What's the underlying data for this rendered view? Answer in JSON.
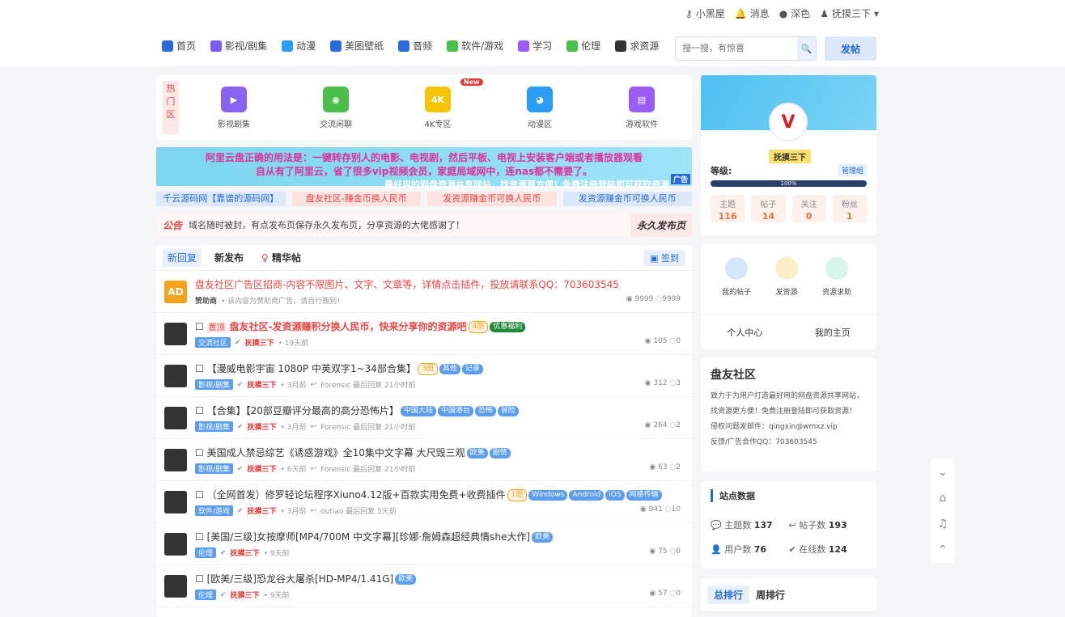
{
  "user": {
    "blackhouse": "小黑屋",
    "messages": "消息",
    "dark": "深色",
    "username": "抚摸三下"
  },
  "nav": {
    "items": [
      {
        "label": "首页",
        "color": "#2a6bd6"
      },
      {
        "label": "影视/剧集",
        "color": "#7b5cf5"
      },
      {
        "label": "动漫",
        "color": "#2a9df4"
      },
      {
        "label": "美图壁纸",
        "color": "#2a6bd6"
      },
      {
        "label": "音频",
        "color": "#2a6bd6"
      },
      {
        "label": "软件/游戏",
        "color": "#4bbf4b"
      },
      {
        "label": "学习",
        "color": "#9b5cf5"
      },
      {
        "label": "伦理",
        "color": "#4bbf4b"
      },
      {
        "label": "求资源",
        "color": "#333333"
      }
    ]
  },
  "search": {
    "placeholder": "搜一搜，有惊喜"
  },
  "post_label": "发帖",
  "hot": {
    "label": "热门区",
    "items": [
      {
        "label": "影视剧集",
        "icon": "video-icon",
        "color": "#8a63f2",
        "glyph": "▶"
      },
      {
        "label": "交流闲聊",
        "icon": "wechat-icon",
        "color": "#4bbf4b",
        "glyph": "◉"
      },
      {
        "label": "4K专区",
        "icon": "4k-icon",
        "color": "#f5c400",
        "glyph": "4K",
        "new": "New"
      },
      {
        "label": "动漫区",
        "icon": "bear-icon",
        "color": "#2a9df4",
        "glyph": "◕"
      },
      {
        "label": "游戏软件",
        "icon": "book-icon",
        "color": "#9b5cf5",
        "glyph": "▤"
      }
    ]
  },
  "banner": {
    "line1": "阿里云盘正确的用法是：一键转存别人的电影、电视剧，然后平板、电视上安装客户端或者播放器观看",
    "line2": "自从有了阿里云，省了很多vip视频会员，家庭局域网中，连nas都不需要了。",
    "line3": "最好用的网盘资源共享网站，找资源更方便！免费注册登陆即可获取资源",
    "tag": "广告"
  },
  "links": [
    {
      "label": "千云源码网【靠谱的源码网】",
      "bg": "#dce8f8",
      "color": "#2a6bd6"
    },
    {
      "label": "盘友社区-赚金币换人民币",
      "bg": "#fde2e2",
      "color": "#e44"
    },
    {
      "label": "发资源赚金币可换人民币",
      "bg": "#fde2e2",
      "color": "#e44"
    },
    {
      "label": "发资源赚金币可换人民币",
      "bg": "#dce8f8",
      "color": "#2a6bd6"
    }
  ],
  "notice": {
    "label": "公告",
    "text": "域名随时被封，有点发布页保存永久发布页，分享资源的大佬感谢了！",
    "perm": "永久发布页"
  },
  "feed_tabs": {
    "new_reply": "新回复",
    "new_post": "新发布",
    "essence": "精华帖",
    "signin": "签到"
  },
  "posts": [
    {
      "title": "盘友社区广告区招商-内容不限图片、文字、文章等，详情点击插件，投放请联系QQ：703603545",
      "titleColor": "#e44",
      "meta1": "赞助商",
      "meta2": "• 该内容为赞助商广告，请自行甄别！",
      "views": "9999",
      "replies": "9999",
      "ad": true
    },
    {
      "title": "盘友社区-发资源赚积分换人民币，快来分享你的资源吧",
      "prefix": "置顶",
      "titleColor": "#e44",
      "badge": "4图",
      "badge2": "优惠福利",
      "cat": "交流社区",
      "user": "抚摸三下",
      "time": "• 19天前",
      "views": "105",
      "replies": "0"
    },
    {
      "title": "【漫威电影宇宙 1080P 中英双字1~34部合集】",
      "badge": "3图",
      "tags": [
        "其他",
        "记录"
      ],
      "cat": "影视/剧集",
      "user": "抚摸三下",
      "time": "• 3月前",
      "last": "Forensic 最后回复 21小时前",
      "views": "312",
      "replies": "3"
    },
    {
      "title": "【合集】【20部豆瓣评分最高的高分恐怖片】",
      "tags": [
        "中国大陆",
        "中国港台",
        "恐怖",
        "冒险"
      ],
      "cat": "影视/剧集",
      "user": "抚摸三下",
      "time": "• 3月前",
      "last": "Forensic 最后回复 21小时前",
      "views": "264",
      "replies": "2"
    },
    {
      "title": "美国成人禁忌综艺《诱惑游戏》全10集中文字幕 大尺毁三观",
      "tags": [
        "欧美",
        "剧情"
      ],
      "cat": "影视/剧集",
      "user": "抚摸三下",
      "time": "• 6天前",
      "last": "Forensic 最后回复 21小时前",
      "views": "63",
      "replies": "2"
    },
    {
      "title": "（全网首发）修罗轻论坛程序Xiuno4.12版+百款实用免费+收费插件",
      "badge": "1图",
      "tags": [
        "Windows",
        "Android",
        "iOS",
        "网络传输"
      ],
      "cat": "软件/游戏",
      "user": "抚摸三下",
      "time": "• 3月前",
      "last": "outiao 最后回复 5天前",
      "views": "941",
      "replies": "10"
    },
    {
      "title": "[美国/三级]女按摩师[MP4/700M 中文字幕][珍娜·詹姆森超经典情she大作]",
      "tags": [
        "欧美"
      ],
      "cat": "伦理",
      "user": "抚摸三下",
      "time": "• 9天前",
      "views": "75",
      "replies": "0"
    },
    {
      "title": "[欧美/三级]恐龙谷大屠杀[HD-MP4/1.41G]",
      "tags": [
        "欧美"
      ],
      "cat": "伦理",
      "user": "抚摸三下",
      "time": "• 9天前",
      "views": "57",
      "replies": "0"
    }
  ],
  "profile": {
    "name": "抚摸三下",
    "level": "等级:",
    "group": "管理组",
    "progress": "100%",
    "stats": [
      {
        "k": "主题",
        "v": "116"
      },
      {
        "k": "帖子",
        "v": "14"
      },
      {
        "k": "关注",
        "v": "0"
      },
      {
        "k": "粉丝",
        "v": "1"
      }
    ]
  },
  "actions": {
    "items": [
      {
        "label": "我的帖子",
        "color": "#d6e6fb"
      },
      {
        "label": "发资源",
        "color": "#fbefc6"
      },
      {
        "label": "资源求助",
        "color": "#d6f5ec"
      }
    ],
    "center": "个人中心",
    "home": "我的主页"
  },
  "about": {
    "title": "盘友社区",
    "desc": "致力于为用户打造最好用的网盘资源共享网站，找资源更方便！免费注册登陆即可获取资源！",
    "email": "侵权问题发邮件：qingxin@wmxz.vip",
    "contact": "反馈/广告合作QQ：703603545"
  },
  "site": {
    "title": "站点数据",
    "topics": "主题数",
    "topics_v": "137",
    "posts": "帖子数",
    "posts_v": "193",
    "users": "用户数",
    "users_v": "76",
    "online": "在线数",
    "online_v": "124"
  },
  "rank": {
    "total": "总排行",
    "week": "周排行"
  }
}
